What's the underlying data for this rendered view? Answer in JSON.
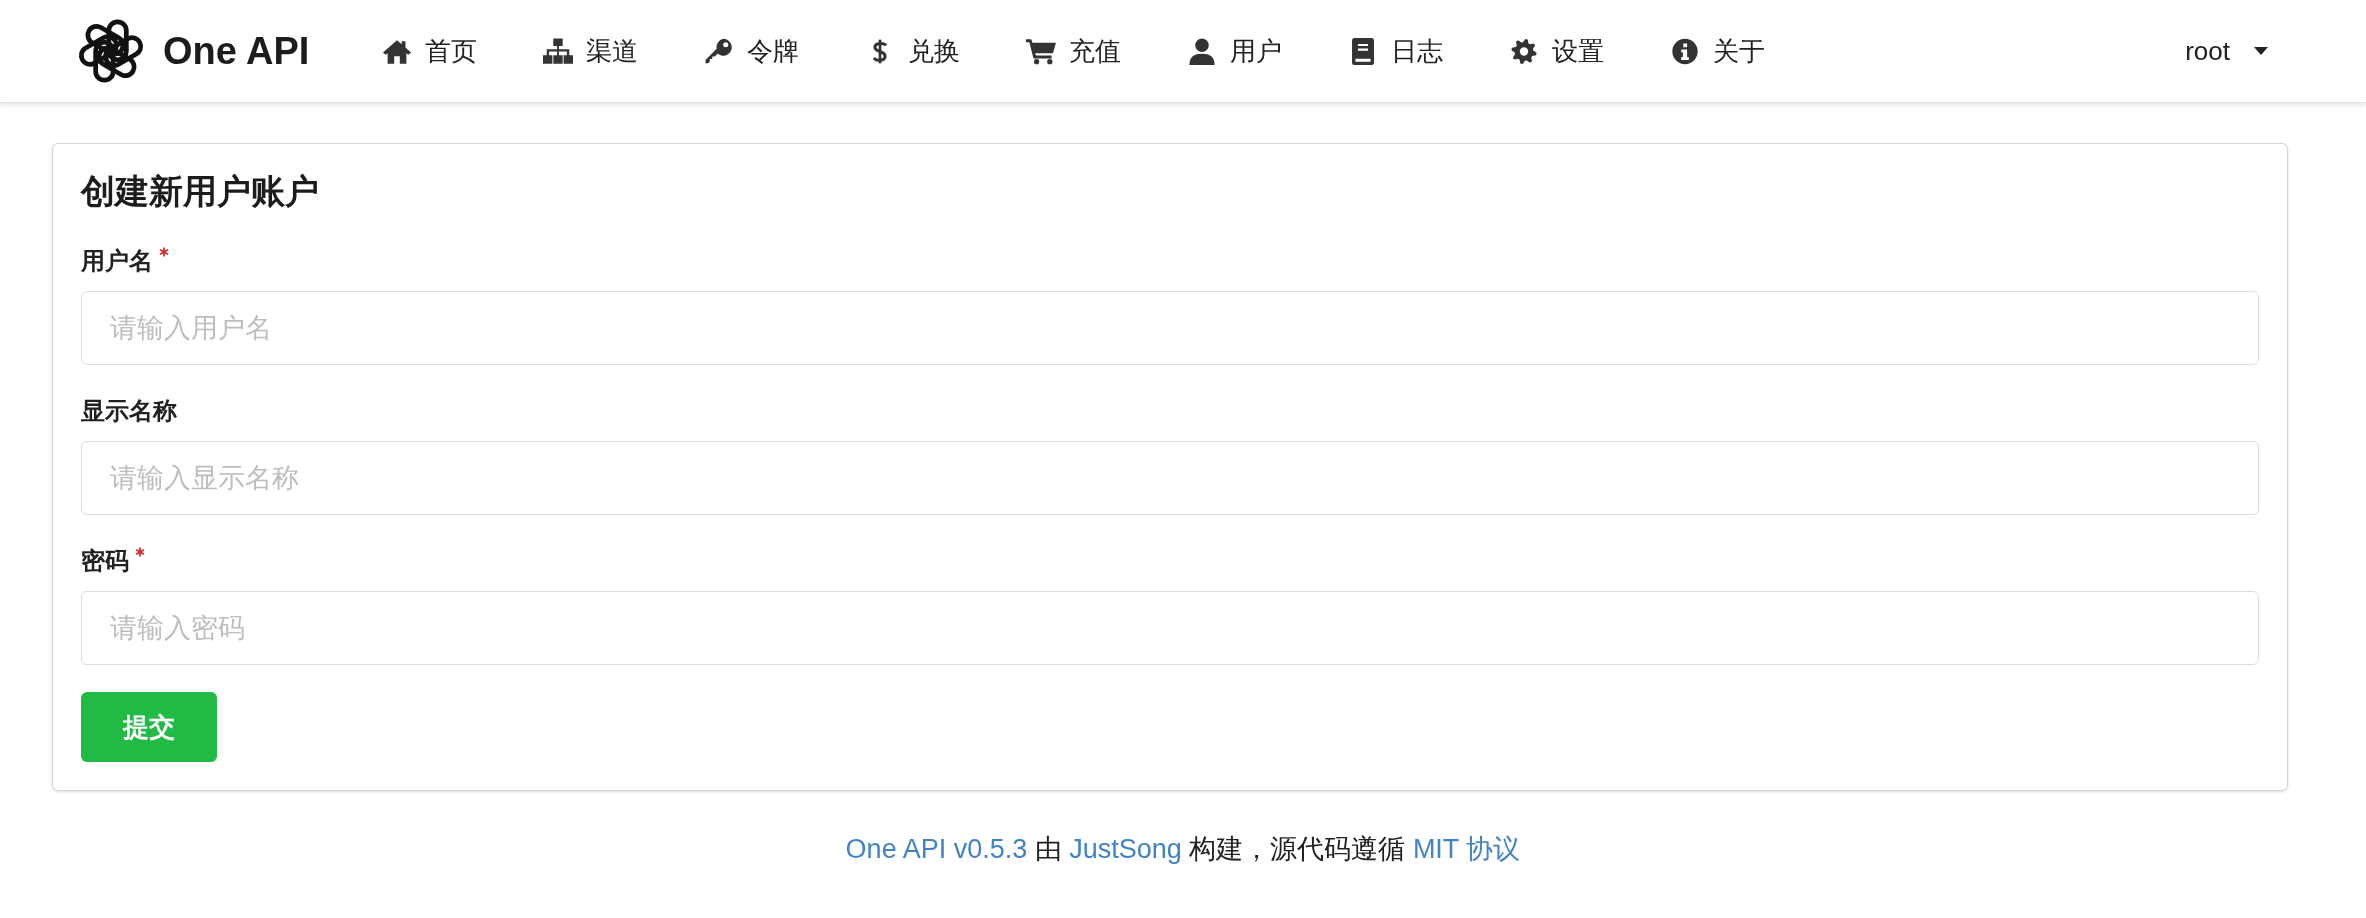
{
  "header": {
    "logo": {
      "text": "One API"
    },
    "nav": [
      {
        "label": "首页",
        "selected": false
      },
      {
        "label": "渠道",
        "selected": false
      },
      {
        "label": "令牌",
        "selected": false
      },
      {
        "label": "兑换",
        "selected": false
      },
      {
        "label": "充值",
        "selected": false
      },
      {
        "label": "用户",
        "selected": false
      },
      {
        "label": "日志",
        "selected": false
      },
      {
        "label": "设置",
        "selected": false
      },
      {
        "label": "关于",
        "selected": false
      }
    ],
    "user_menu": {
      "label": "root"
    }
  },
  "form": {
    "title": "创建新用户账户",
    "fields": [
      {
        "label": "用户名",
        "required": true,
        "placeholder": "请输入用户名"
      },
      {
        "label": "显示名称",
        "required": false,
        "placeholder": "请输入显示名称"
      },
      {
        "label": "密码",
        "required": true,
        "placeholder": "请输入密码"
      }
    ],
    "submit_button": {
      "label": "提交"
    }
  },
  "footer": {
    "parts": [
      {
        "kind": "link",
        "text": "One API v0.5.3"
      },
      {
        "kind": "text",
        "text": "由"
      },
      {
        "kind": "link",
        "text": "JustSong"
      },
      {
        "kind": "text",
        "text": "构建，源代码遵循"
      },
      {
        "kind": "link",
        "text": "MIT 协议"
      }
    ]
  }
}
